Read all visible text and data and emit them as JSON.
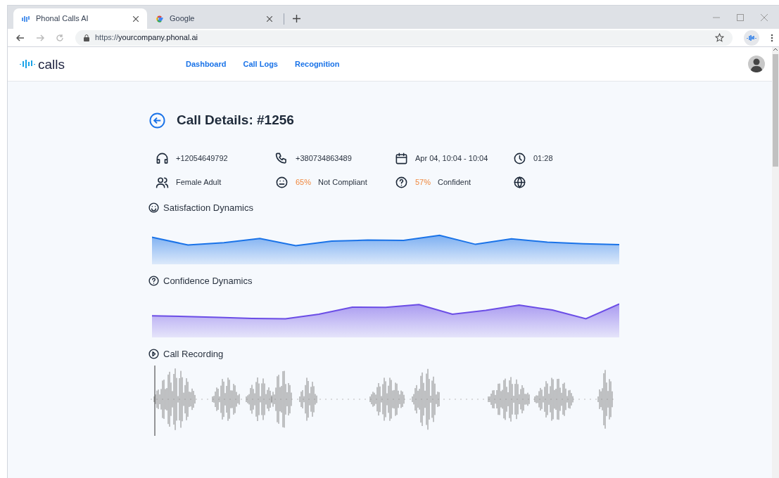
{
  "browser": {
    "tabs": [
      {
        "title": "Phonal Calls AI",
        "selected": true
      },
      {
        "title": "Google",
        "selected": false
      }
    ],
    "url_prefix": "https://",
    "url_domain": "yourcompany.phonal.ai"
  },
  "nav": {
    "logo": "calls",
    "links": [
      {
        "label": "Dashboard"
      },
      {
        "label": "Call Logs"
      },
      {
        "label": "Recognition"
      }
    ]
  },
  "title": "Call Details: #1256",
  "details": [
    {
      "text": "+12054649792"
    },
    {
      "text": "+380734863489"
    },
    {
      "text": "Apr 04, 10:04 - 10:04"
    },
    {
      "text": "01:28"
    },
    {
      "text": "Female Adult"
    },
    {
      "percent": "65%",
      "text": "Not Compliant"
    },
    {
      "percent": "57%",
      "text": "Confident"
    }
  ],
  "sections": [
    {
      "kind": "chart",
      "title": "Satisfaction Dynamics"
    },
    {
      "kind": "chart",
      "title": "Confidence Dynamics"
    },
    {
      "kind": "audio",
      "title": "Call Recording"
    }
  ]
}
